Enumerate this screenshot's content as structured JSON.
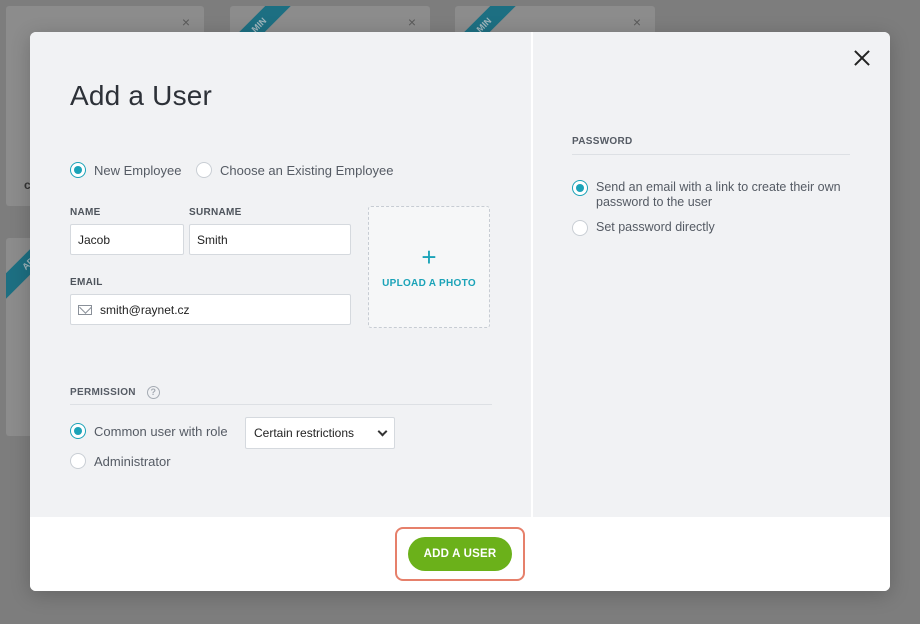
{
  "background": {
    "cards": [
      {
        "fragment": "cr",
        "ribbon": ""
      },
      {
        "fragment": "",
        "ribbon": "MIN"
      },
      {
        "fragment": "",
        "ribbon": "MIN"
      },
      {
        "fragment": "",
        "ribbon": "ADM"
      }
    ],
    "close_glyph": "×"
  },
  "modal": {
    "title": "Add a User",
    "close_icon": "close-icon",
    "employee_options": [
      {
        "label": "New Employee",
        "checked": true
      },
      {
        "label": "Choose an Existing Employee",
        "checked": false
      }
    ],
    "name": {
      "label": "NAME",
      "value": "Jacob"
    },
    "surname": {
      "label": "SURNAME",
      "value": "Smith"
    },
    "email": {
      "label": "EMAIL",
      "value": "smith@raynet.cz",
      "icon": "mail-icon"
    },
    "upload": {
      "plus": "+",
      "label": "UPLOAD A PHOTO"
    },
    "permission": {
      "title": "PERMISSION",
      "help": "?",
      "options": [
        {
          "label": "Common user with role",
          "checked": true
        },
        {
          "label": "Administrator",
          "checked": false
        }
      ],
      "role_select": "Certain restrictions"
    },
    "password": {
      "title": "PASSWORD",
      "options": [
        {
          "label": "Send an email with a link to create their own password to the user",
          "checked": true
        },
        {
          "label": "Set password directly",
          "checked": false
        }
      ]
    },
    "submit_label": "ADD A USER"
  },
  "colors": {
    "accent": "#1ba3b8",
    "submit": "#6bb11a",
    "highlight": "#e6806b"
  }
}
